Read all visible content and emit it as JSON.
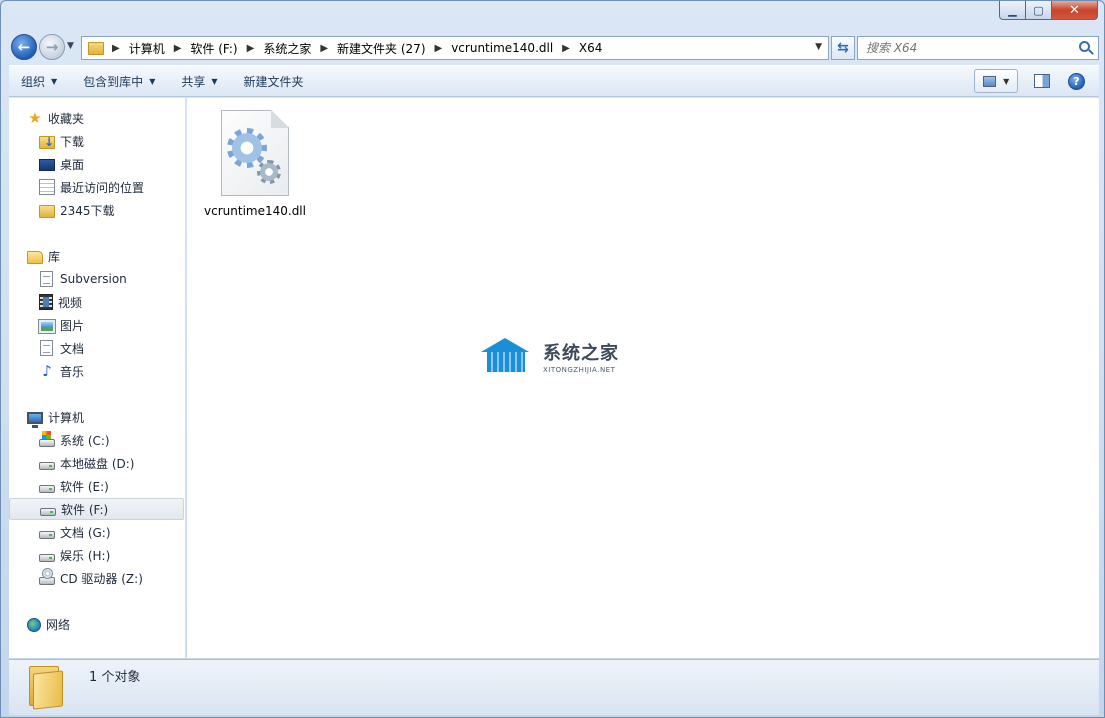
{
  "window": {
    "caption": {
      "minimize": "▁",
      "maximize": "▢",
      "close": "✕"
    }
  },
  "address_bar": {
    "crumbs": [
      "计算机",
      "软件 (F:)",
      "系统之家",
      "新建文件夹 (27)",
      "vcruntime140.dll",
      "X64"
    ]
  },
  "search": {
    "placeholder": "搜索 X64"
  },
  "command_bar": {
    "organize": "组织",
    "include_in_library": "包含到库中",
    "share": "共享",
    "new_folder": "新建文件夹"
  },
  "nav_pane": {
    "favorites": {
      "label": "收藏夹",
      "items": [
        "下载",
        "桌面",
        "最近访问的位置",
        "2345下载"
      ]
    },
    "libraries": {
      "label": "库",
      "items": [
        "Subversion",
        "视频",
        "图片",
        "文档",
        "音乐"
      ]
    },
    "computer": {
      "label": "计算机",
      "items": [
        "系统 (C:)",
        "本地磁盘 (D:)",
        "软件 (E:)",
        "软件 (F:)",
        "文档 (G:)",
        "娱乐 (H:)",
        "CD 驱动器 (Z:)"
      ]
    },
    "network": {
      "label": "网络"
    }
  },
  "content": {
    "files": [
      {
        "name": "vcruntime140.dll",
        "icon": "dll-gear-icon"
      }
    ],
    "watermark": {
      "title": "系统之家",
      "subtitle": "XITONGZHIJIA.NET"
    }
  },
  "details_pane": {
    "text": "1 个对象"
  }
}
